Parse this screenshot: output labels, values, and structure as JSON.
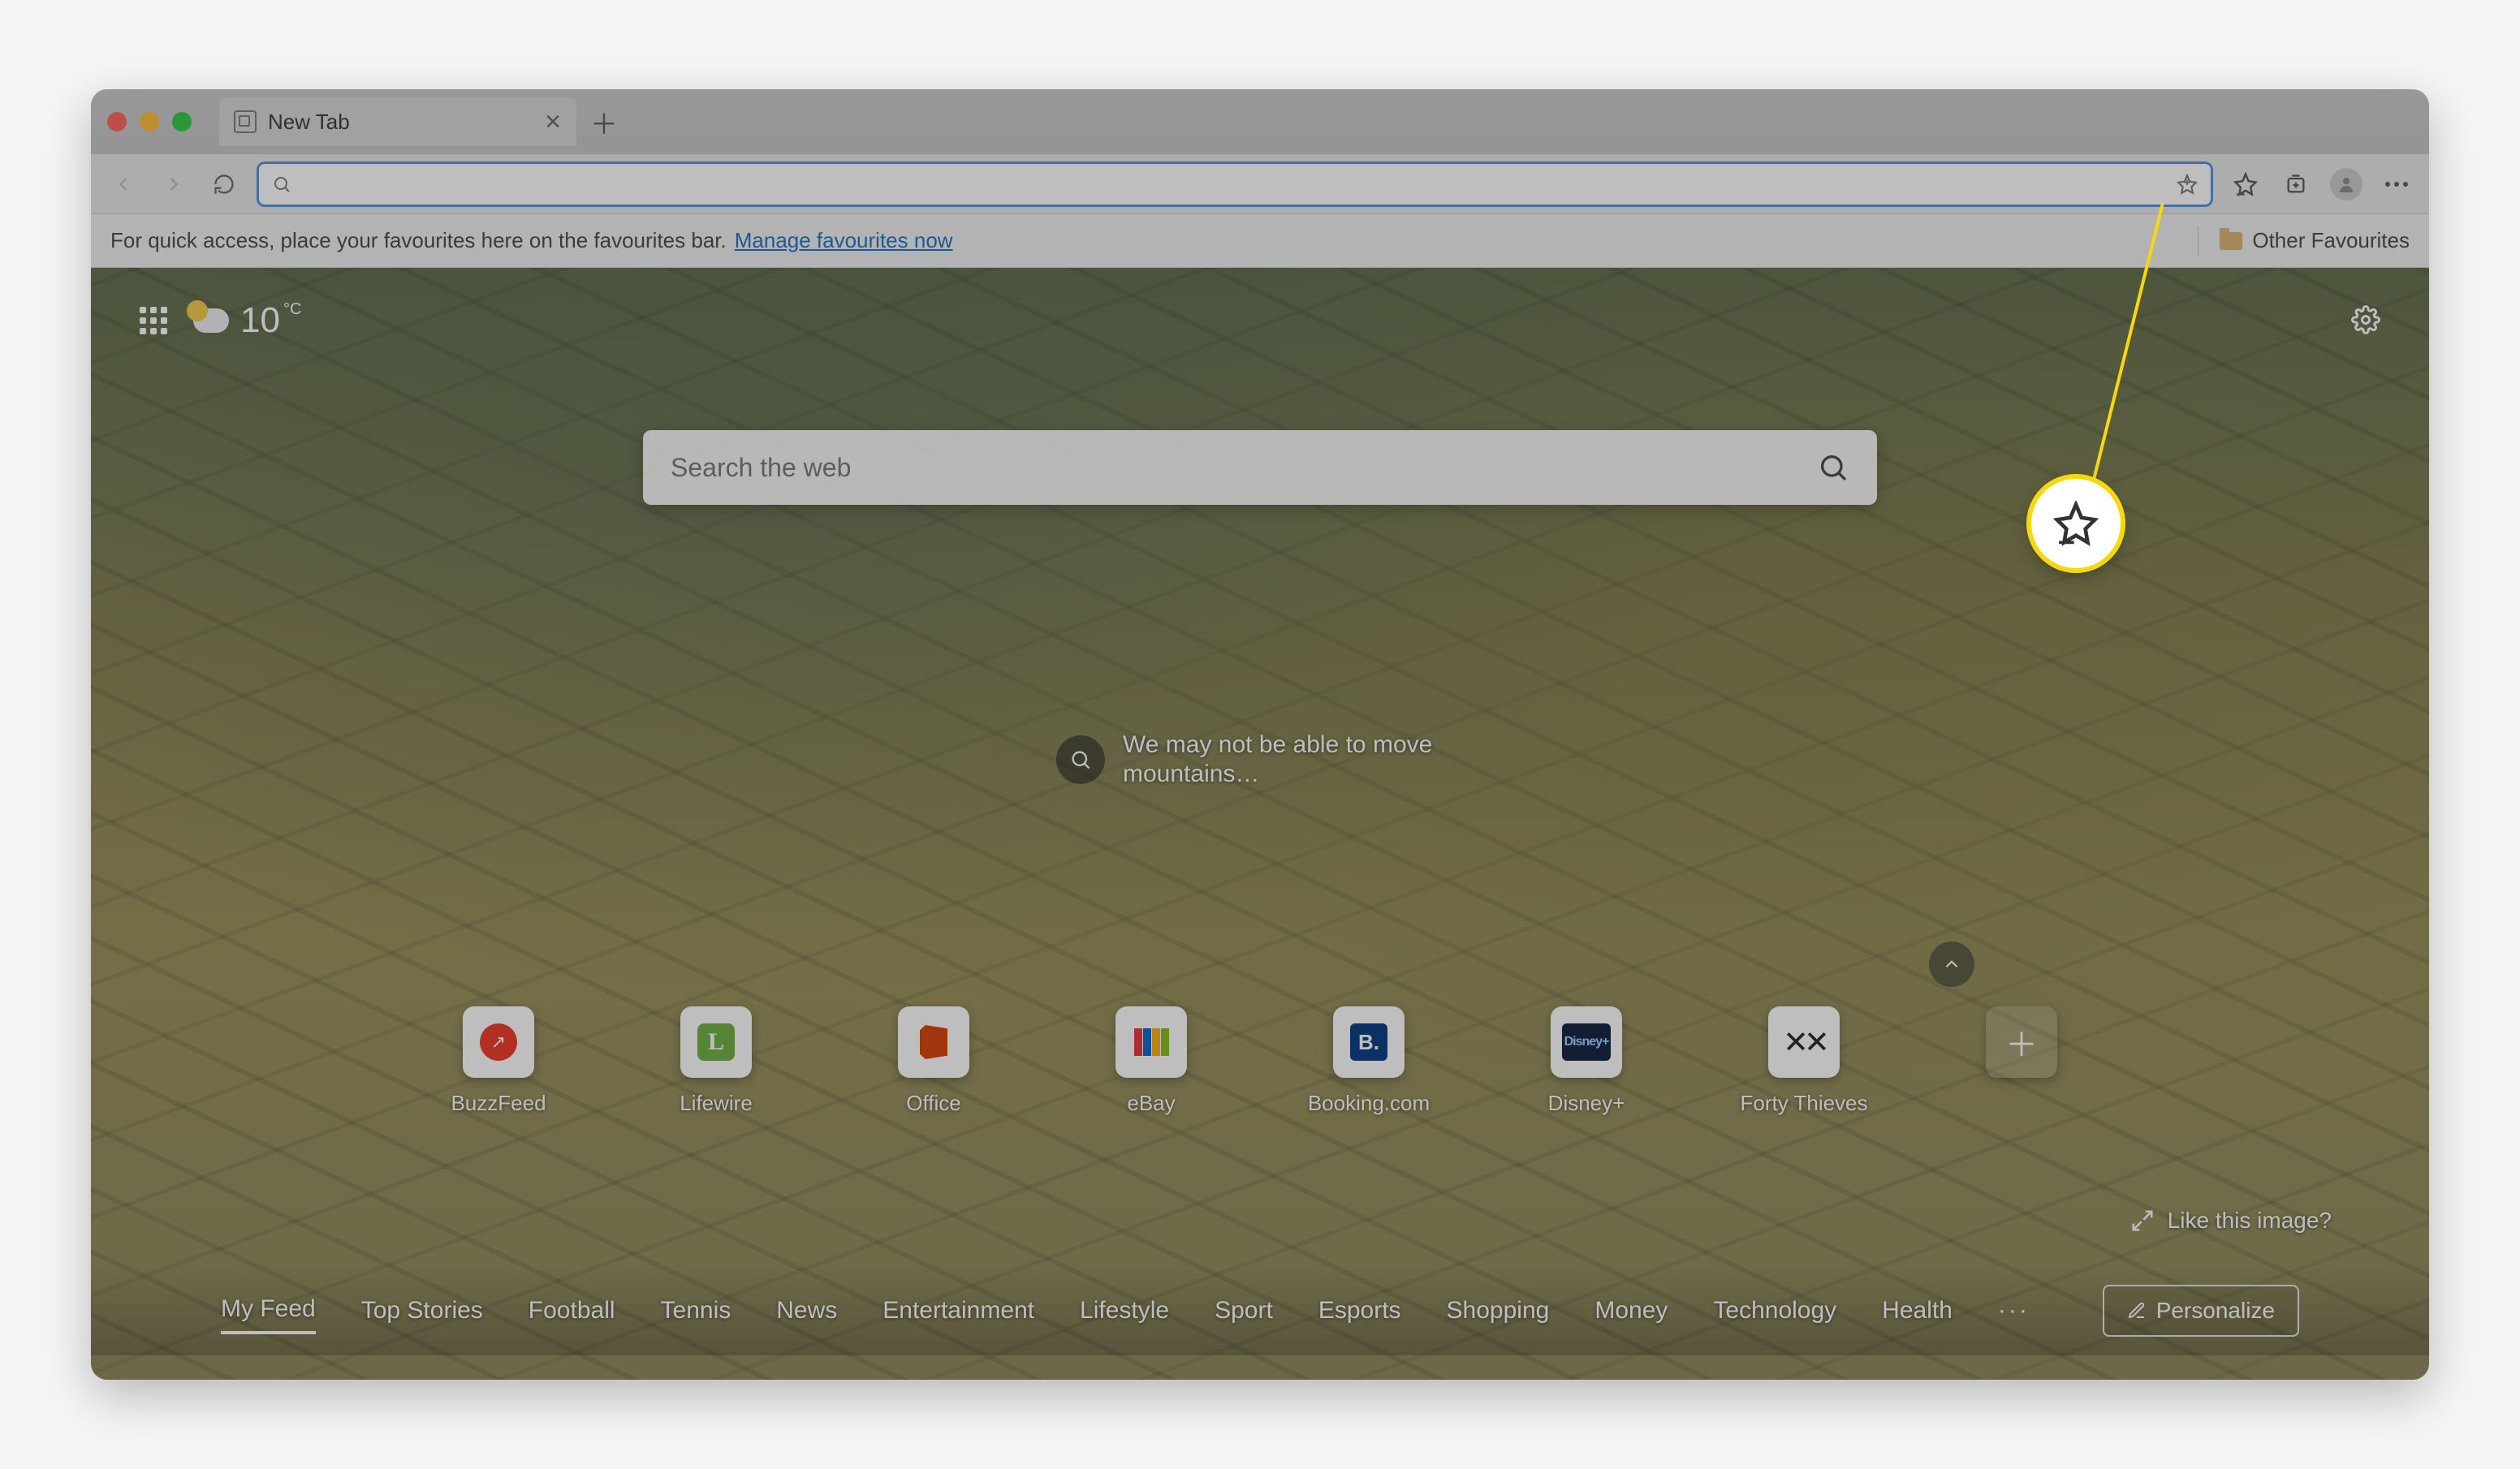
{
  "tab": {
    "title": "New Tab"
  },
  "bookmarks_bar": {
    "hint": "For quick access, place your favourites here on the favourites bar.",
    "manage_link": "Manage favourites now",
    "other_folder": "Other Favourites"
  },
  "weather": {
    "temp": "10",
    "unit": "°C"
  },
  "search": {
    "placeholder": "Search the web"
  },
  "quote": {
    "text": "We may not be able to move mountains…"
  },
  "tiles": [
    {
      "label": "BuzzFeed"
    },
    {
      "label": "Lifewire"
    },
    {
      "label": "Office"
    },
    {
      "label": "eBay"
    },
    {
      "label": "Booking.com"
    },
    {
      "label": "Disney+"
    },
    {
      "label": "Forty Thieves"
    }
  ],
  "like_image": "Like this image?",
  "feed_tabs": [
    "My Feed",
    "Top Stories",
    "Football",
    "Tennis",
    "News",
    "Entertainment",
    "Lifestyle",
    "Sport",
    "Esports",
    "Shopping",
    "Money",
    "Technology",
    "Health"
  ],
  "feed_more": "···",
  "personalize": "Personalize",
  "annotation": {
    "target": "favourites-button"
  }
}
